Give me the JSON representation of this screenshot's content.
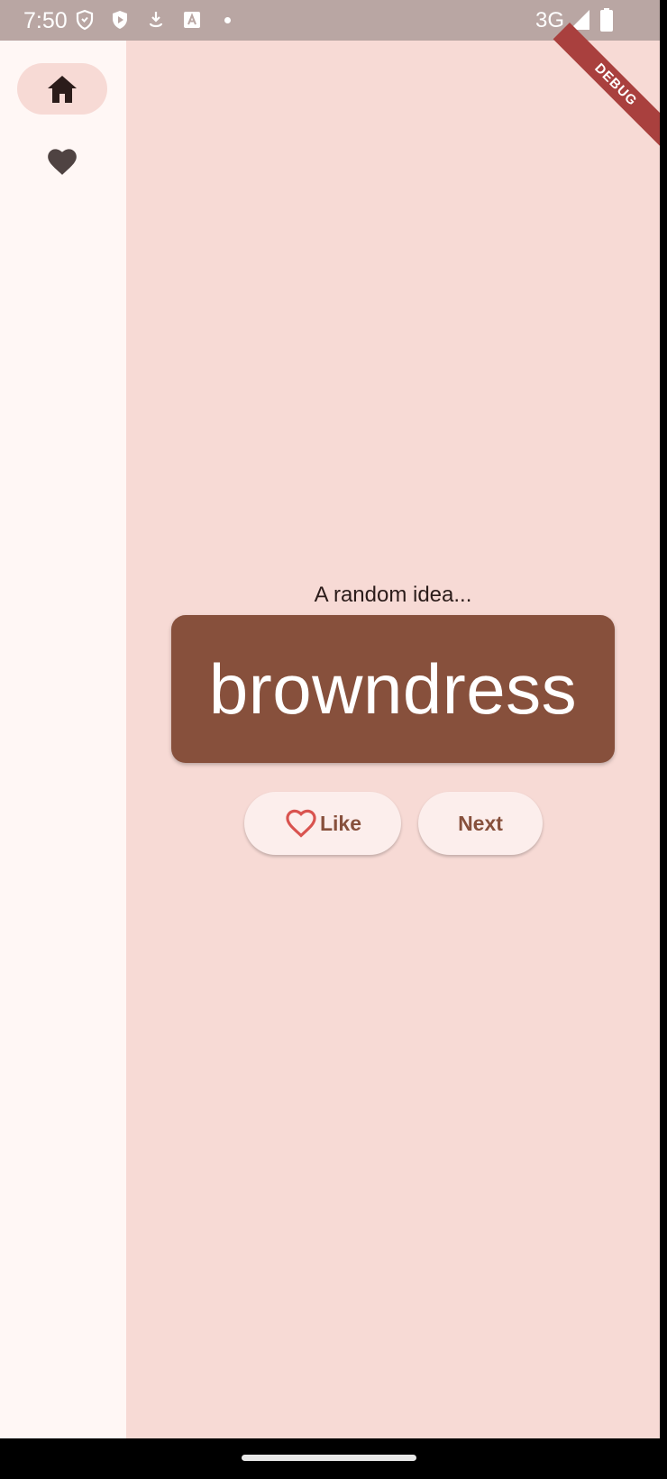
{
  "status_bar": {
    "time": "7:50",
    "icons": [
      "shield-outline-icon",
      "play-protect-icon",
      "download-icon",
      "translate-icon",
      "notification-dot-icon"
    ],
    "network": "3G",
    "right_icons": [
      "signal-icon",
      "battery-icon"
    ]
  },
  "debug_banner": {
    "label": "DEBUG",
    "color": "#A9403E"
  },
  "nav_rail": {
    "items": [
      {
        "name": "home",
        "icon": "home-icon",
        "selected": true
      },
      {
        "name": "favorites",
        "icon": "heart-icon",
        "selected": false
      }
    ]
  },
  "main": {
    "caption": "A random idea...",
    "idea": "browndress",
    "buttons": {
      "like_label": "Like",
      "like_icon": "heart-outline-icon",
      "next_label": "Next"
    }
  },
  "colors": {
    "background": "#F7DAD5",
    "rail_background": "#FFF7F5",
    "card": "#87503C",
    "button_background": "#FCEEEC",
    "accent_text": "#87503C",
    "like_icon": "#D9534F"
  }
}
